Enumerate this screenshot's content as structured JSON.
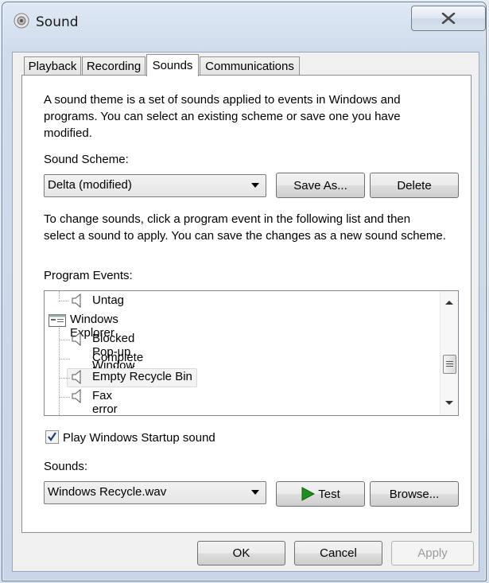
{
  "window": {
    "title": "Sound"
  },
  "tabs": [
    {
      "label": "Playback"
    },
    {
      "label": "Recording"
    },
    {
      "label": "Sounds"
    },
    {
      "label": "Communications"
    }
  ],
  "sounds_tab": {
    "description": [
      "A sound theme is a set of sounds applied to events in Windows and",
      "programs.  You can select an existing scheme or save one you have",
      "modified."
    ],
    "scheme_label": "Sound Scheme:",
    "scheme_value": "Delta (modified)",
    "save_as_label": "Save As...",
    "delete_label": "Delete",
    "change_text": [
      "To change sounds, click a program event in the following list and then",
      "select a sound to apply.  You can save the changes as a new sound scheme."
    ],
    "events_label": "Program Events:",
    "events": [
      {
        "label": "Untag",
        "icon": "speaker-icon"
      },
      {
        "label": "Windows Explorer",
        "icon": "window-icon"
      },
      {
        "label": "Blocked Pop-up Window",
        "icon": "speaker-icon"
      },
      {
        "label": "Complete Navigation",
        "icon": ""
      },
      {
        "label": "Empty Recycle Bin",
        "icon": "speaker-icon"
      },
      {
        "label": "Fax error",
        "icon": "speaker-icon"
      }
    ],
    "startup_label": "Play Windows Startup sound",
    "startup_checked": true,
    "sounds_label": "Sounds:",
    "sound_value": "Windows Recycle.wav",
    "test_label": "Test",
    "browse_label": "Browse..."
  },
  "footer": {
    "ok_label": "OK",
    "cancel_label": "Cancel",
    "apply_label": "Apply"
  },
  "colors": {
    "accent_green": "#1f8f1f",
    "window_frame": "#c8d6e8"
  }
}
